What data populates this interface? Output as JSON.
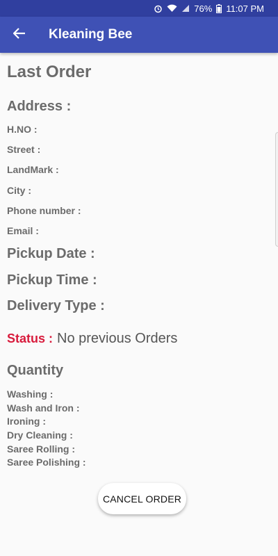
{
  "status_bar": {
    "battery": "76%",
    "time": "11:07 PM",
    "icons": [
      "alarm-icon",
      "wifi-icon",
      "signal-icon",
      "battery-icon"
    ]
  },
  "app_bar": {
    "title": "Kleaning Bee",
    "back_icon": "arrow-back-icon"
  },
  "order": {
    "heading": "Last Order",
    "address_heading": "Address :",
    "address_fields": {
      "hno": "H.NO :",
      "street": "Street :",
      "landmark": "LandMark :",
      "city": "City :",
      "phone": "Phone number :",
      "email": "Email :"
    },
    "pickup_date": "Pickup Date :",
    "pickup_time": "Pickup Time :",
    "delivery_type": "Delivery Type :",
    "status_label": "Status :",
    "status_value": "No previous Orders",
    "quantity_heading": "Quantity",
    "quantity_fields": {
      "washing": "Washing :",
      "wash_iron": "Wash and Iron :",
      "ironing": "Ironing :",
      "dry_cleaning": "Dry Cleaning :",
      "saree_rolling": "Saree Rolling :",
      "saree_polishing": "Saree Polishing :"
    }
  },
  "actions": {
    "cancel_label": "CANCEL ORDER"
  },
  "colors": {
    "app_bar": "#3f51b5",
    "status_bar": "#303f9f",
    "status_label": "#d81b3c",
    "text": "#6b6b6b"
  }
}
